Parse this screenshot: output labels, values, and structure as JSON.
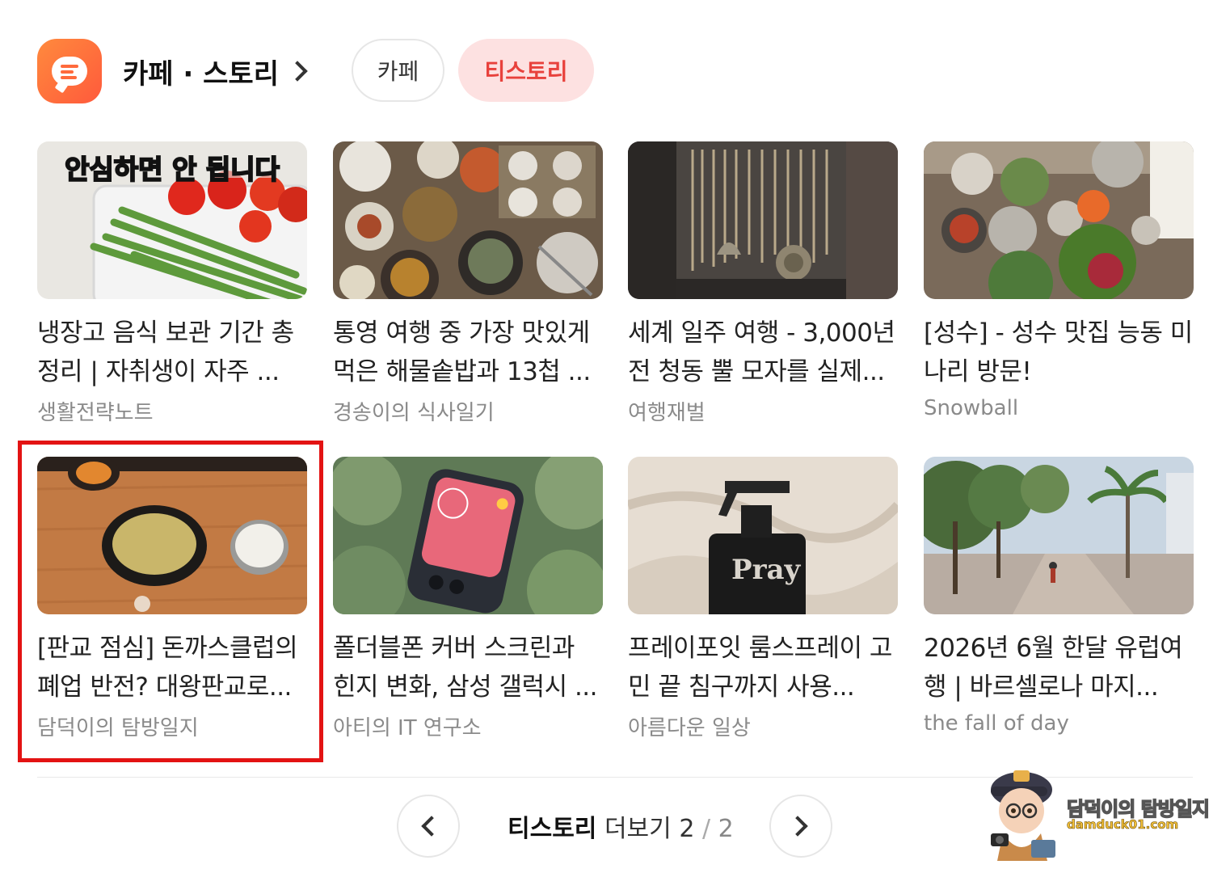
{
  "header": {
    "title": "카페 · 스토리",
    "tabs": [
      {
        "label": "카페",
        "active": false
      },
      {
        "label": "티스토리",
        "active": true
      }
    ]
  },
  "cards": [
    {
      "title": "냉장고 음식 보관 기간 총정리 | 자취생이 자주 ...",
      "author": "생활전략노트",
      "thumb_text": "안심하면 안 됩니다"
    },
    {
      "title": "통영 여행 중 가장 맛있게 먹은 해물솥밥과 13첩 ...",
      "author": "경송이의 식사일기"
    },
    {
      "title": "세계 일주 여행 - 3,000년 전 청동 뿔 모자를 실제...",
      "author": "여행재벌"
    },
    {
      "title": "[성수] - 성수 맛집 능동 미나리 방문!",
      "author": "Snowball"
    },
    {
      "title": "[판교 점심] 돈까스클럽의 폐업 반전? 대왕판교로...",
      "author": "담덕이의 탐방일지"
    },
    {
      "title": "폴더블폰 커버 스크린과 힌지 변화, 삼성 갤럭시 ...",
      "author": "아티의 IT 연구소"
    },
    {
      "title": "프레이포잇 룸스프레이 고민 끝 침구까지 사용...",
      "author": "아름다운 일상",
      "thumb_text": "Pray"
    },
    {
      "title": "2026년 6월 한달 유럽여행 | 바르셀로나 마지...",
      "author": "the fall of day"
    }
  ],
  "pager": {
    "brand": "티스토리",
    "more": "더보기",
    "current": "2",
    "slash": "/",
    "total": "2"
  },
  "watermark": {
    "name": "담덕이의 탐방일지",
    "url": "damduck01.com"
  },
  "colors": {
    "accent": "#e8413c",
    "chip_active_bg": "#fde1e1",
    "highlight": "#e31313",
    "app_icon": "#ff6a3c"
  }
}
